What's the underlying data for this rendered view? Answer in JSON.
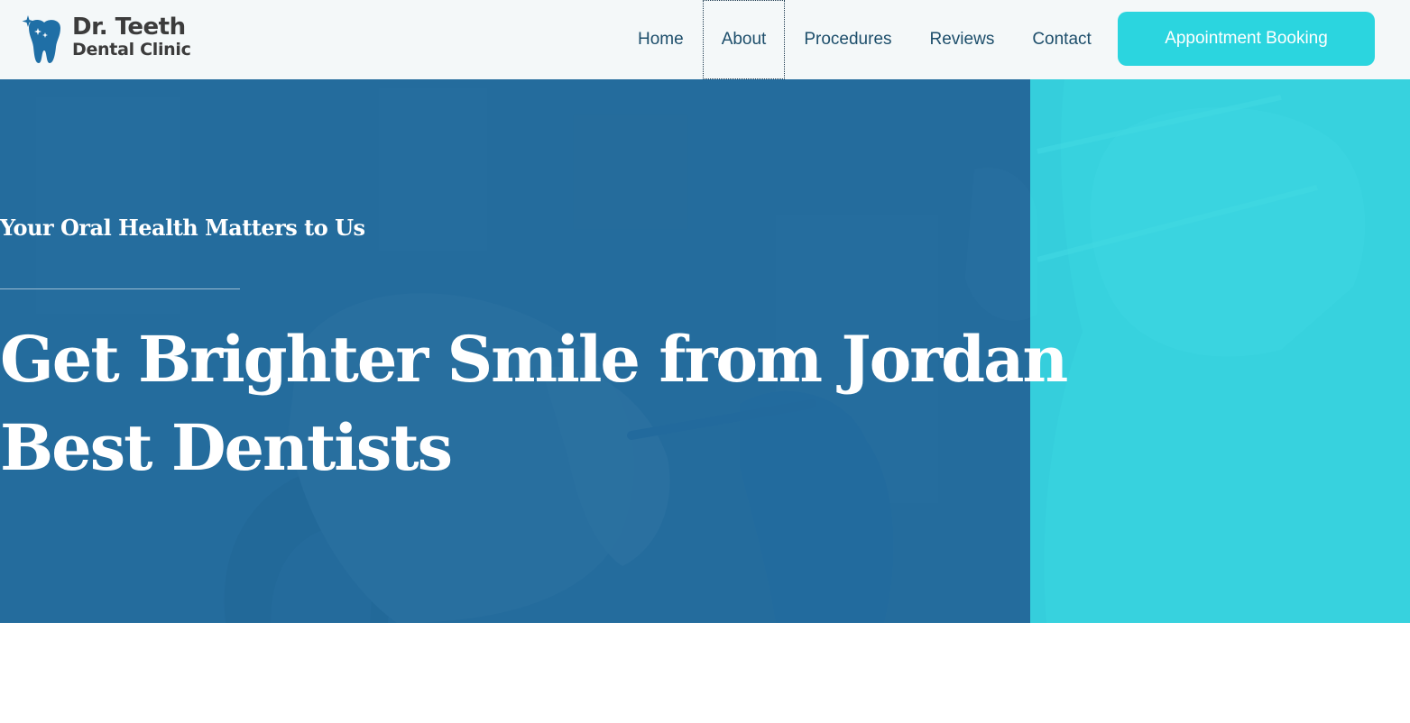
{
  "brand": {
    "name_line1": "Dr. Teeth",
    "name_line2": "Dental Clinic",
    "icon": "tooth-sparkle-icon",
    "colors": {
      "logo_blue": "#1f6fa6",
      "logo_text": "#3c3c3c"
    }
  },
  "nav": {
    "items": [
      {
        "label": "Home"
      },
      {
        "label": "About"
      },
      {
        "label": "Procedures"
      },
      {
        "label": "Reviews"
      },
      {
        "label": "Contact"
      }
    ],
    "focused_item": "About",
    "cta_label": "Appointment Booking"
  },
  "hero": {
    "subtitle": "Your Oral Health Matters to Us",
    "title": "Get Brighter Smile from Jordan Best Dentists",
    "background_image": "dentist-treating-patient-photo"
  },
  "colors": {
    "header_bg": "#f4f8f9",
    "nav_text": "#1d4e6b",
    "accent_teal": "#2bd5df",
    "hero_blue": "#216898",
    "hero_teal": "#34d6e0"
  }
}
